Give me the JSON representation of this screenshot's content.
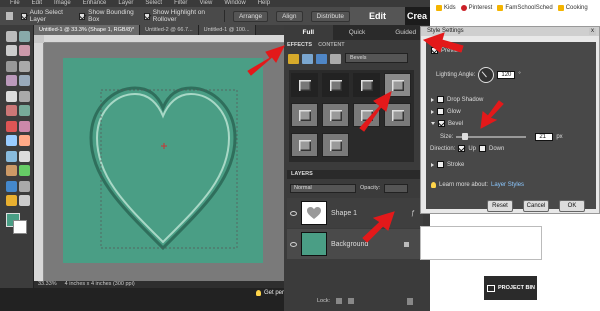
{
  "menubar": {
    "items": [
      "File",
      "Edit",
      "Image",
      "Enhance",
      "Layer",
      "Select",
      "Filter",
      "View",
      "Window",
      "Help"
    ]
  },
  "options": {
    "auto_select": "Auto Select Layer",
    "bounding": "Show Bounding Box",
    "highlight": "Show Highlight on Rollover",
    "arrange": "Arrange",
    "align": "Align",
    "distribute": "Distribute"
  },
  "mode_tabs": {
    "edit": "Edit",
    "create": "Crea"
  },
  "doc_tabs": [
    "Untitled-1 @ 33.3% (Shape 1, RGB/8)*",
    "Untitled-2 @ 66.7...",
    "Untitled-1 @ 100..."
  ],
  "status": {
    "zoom": "33.33%",
    "docsize": "4 inches x 4 inches (300 ppi)"
  },
  "tip": "Get perf",
  "panel_tabs": {
    "full": "Full",
    "quick": "Quick",
    "guided": "Guided"
  },
  "effects": {
    "tab_effects": "EFFECTS",
    "tab_content": "CONTENT",
    "category": "Bevels"
  },
  "layers": {
    "header": "LAYERS",
    "blend_mode": "Normal",
    "opacity_label": "Opacity:",
    "lock_label": "Lock:",
    "items": [
      {
        "name": "Shape 1"
      },
      {
        "name": "Background"
      }
    ]
  },
  "dialog": {
    "title": "Style Settings",
    "close": "x",
    "preview": "Preview",
    "lighting_label": "Lighting Angle:",
    "lighting_value": "120",
    "lighting_unit": "°",
    "drop_shadow": "Drop Shadow",
    "glow": "Glow",
    "bevel": "Bevel",
    "size_label": "Size:",
    "size_value": "21",
    "size_unit": "px",
    "direction_label": "Direction:",
    "dir_up": "Up",
    "dir_down": "Down",
    "stroke": "Stroke",
    "learn_more": "Learn more about:",
    "learn_link": "Layer Styles",
    "reset": "Reset",
    "cancel": "Cancel",
    "ok": "OK"
  },
  "bookmarks": [
    "Kids",
    "Pinterest",
    "FamSchoolSched",
    "Cooking"
  ],
  "project_bin": "PROJECT BIN",
  "colors": {
    "canvas": "#4a9e85",
    "arrow": "#e3191a"
  }
}
